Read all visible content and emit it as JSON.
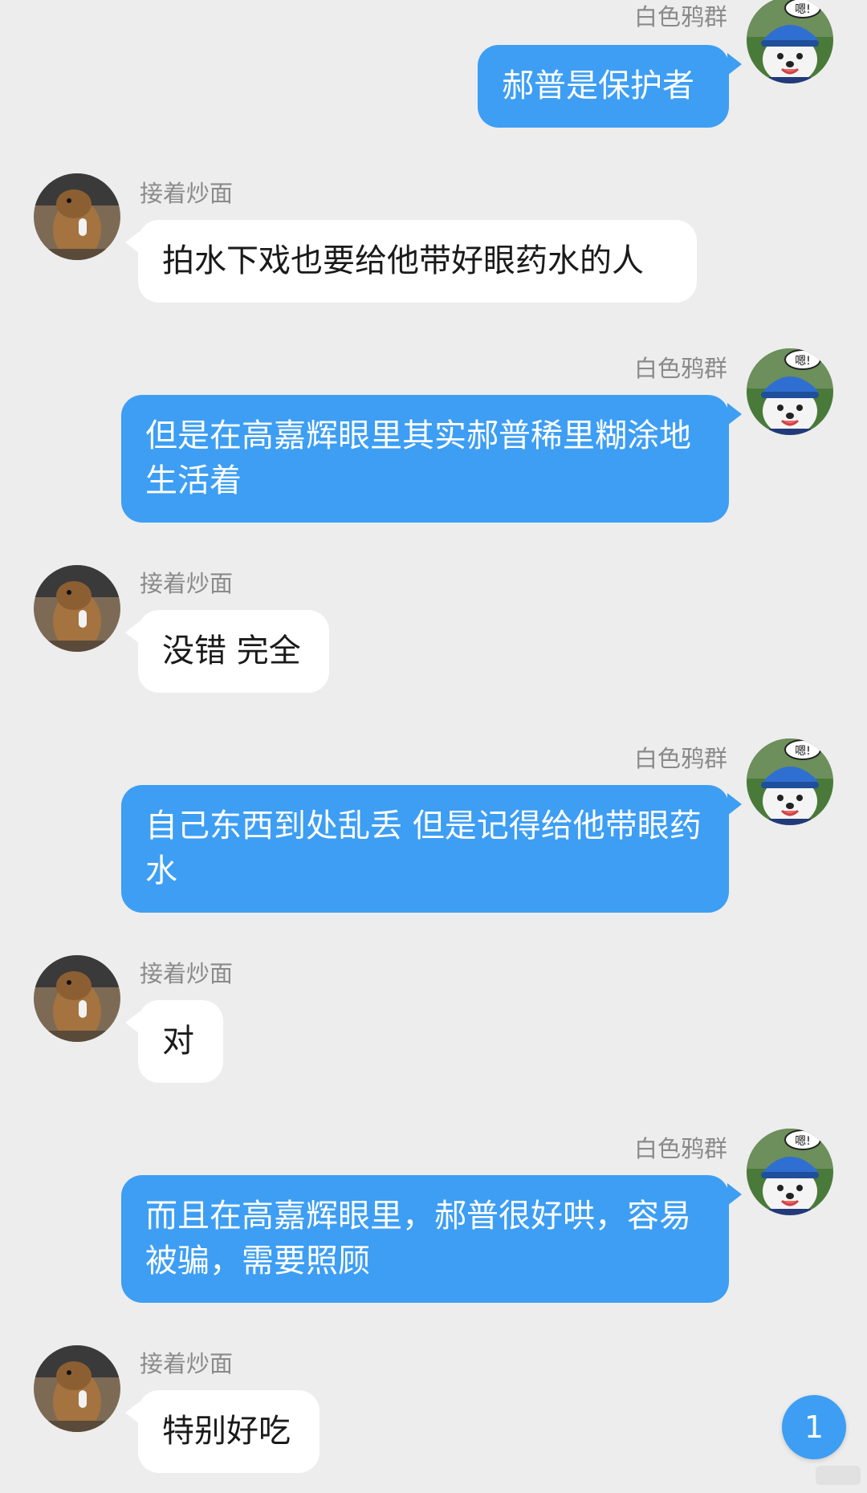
{
  "users": {
    "self_name": "白色鸦群",
    "other_name": "接着炒面",
    "self_avatar_bubble_text": "嗯!"
  },
  "messages": [
    {
      "sender": "白色鸦群",
      "text": "郝普是保护者"
    },
    {
      "sender": "接着炒面",
      "text": "拍水下戏也要给他带好眼药水的人"
    },
    {
      "sender": "白色鸦群",
      "text": "但是在高嘉辉眼里其实郝普稀里糊涂地生活着"
    },
    {
      "sender": "接着炒面",
      "text": "没错 完全"
    },
    {
      "sender": "白色鸦群",
      "text": "自己东西到处乱丢 但是记得给他带眼药水"
    },
    {
      "sender": "接着炒面",
      "text": "对"
    },
    {
      "sender": "白色鸦群",
      "text": "而且在高嘉辉眼里，郝普很好哄，容易被骗，需要照顾"
    },
    {
      "sender": "接着炒面",
      "text": "特别好吃"
    }
  ],
  "unread_badge": "1",
  "colors": {
    "outgoing_bubble": "#3d9ef3",
    "incoming_bubble": "#ffffff",
    "background": "#ededed"
  }
}
